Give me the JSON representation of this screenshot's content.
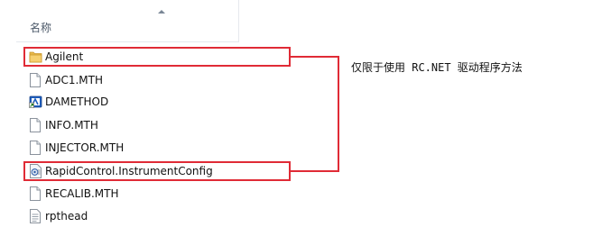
{
  "file_list": {
    "column_header": "名称",
    "items": [
      {
        "name": "Agilent",
        "icon": "folder-icon"
      },
      {
        "name": "ADC1.MTH",
        "icon": "document-icon"
      },
      {
        "name": "DAMETHOD",
        "icon": "app-shortcut-icon"
      },
      {
        "name": "INFO.MTH",
        "icon": "document-icon"
      },
      {
        "name": "INJECTOR.MTH",
        "icon": "document-icon"
      },
      {
        "name": "RapidControl.InstrumentConfig",
        "icon": "config-file-icon"
      },
      {
        "name": "RECALIB.MTH",
        "icon": "document-icon"
      },
      {
        "name": "rpthead",
        "icon": "text-file-icon"
      }
    ]
  },
  "annotation": {
    "text": "仅限于使用 RC.NET 驱动程序方法",
    "color": "#e02b36"
  }
}
